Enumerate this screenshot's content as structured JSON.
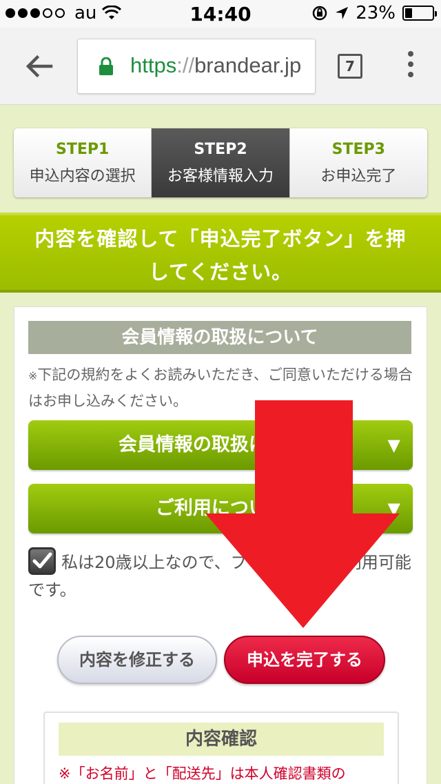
{
  "status": {
    "carrier": "au",
    "time": "14:40",
    "battery": "23%"
  },
  "browser": {
    "url_scheme": "https",
    "url_sep": "://",
    "url_host": "brandear.jp",
    "tab_count": "7"
  },
  "steps": [
    {
      "num": "STEP1",
      "label": "申込内容の選択"
    },
    {
      "num": "STEP2",
      "label": "お客様情報入力"
    },
    {
      "num": "STEP3",
      "label": "お申込完了"
    }
  ],
  "banner": {
    "line1": "内容を確認して「申込完了ボタン」を押",
    "line2": "してください。"
  },
  "section": {
    "title": "会員情報の取扱について",
    "note_mark": "※",
    "note": "下記の規約をよくお読みいただき、ご同意いただける場合はお申し込みください。"
  },
  "accordions": [
    {
      "label": "会員情報の取扱について",
      "arrow": "▼"
    },
    {
      "label": "ご利用について",
      "arrow": "▼"
    }
  ],
  "agree": {
    "text": "私は20歳以上なので、ブランディアを利用可能です。"
  },
  "buttons": {
    "edit": "内容を修正する",
    "submit": "申込を完了する"
  },
  "confirm": {
    "title": "内容確認",
    "note": "※「お名前」と「配送先」は本人確認書類の"
  },
  "colors": {
    "accent_green": "#9bbd00",
    "submit_red": "#d6002e",
    "arrow_red": "#ee1c24"
  }
}
